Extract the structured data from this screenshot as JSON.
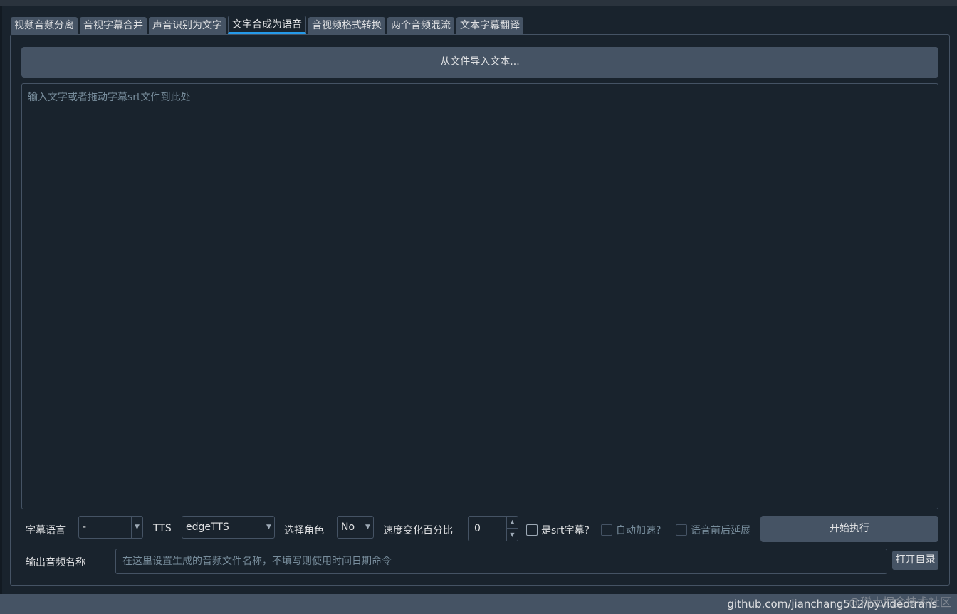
{
  "tabs": [
    {
      "label": "视频音频分离"
    },
    {
      "label": "音视字幕合并"
    },
    {
      "label": "声音识别为文字"
    },
    {
      "label": "文字合成为语音"
    },
    {
      "label": "音视频格式转换"
    },
    {
      "label": "两个音频混流"
    },
    {
      "label": "文本字幕翻译"
    }
  ],
  "active_tab": "文字合成为语音",
  "import_button": "从文件导入文本...",
  "text_area": {
    "placeholder": "输入文字或者拖动字幕srt文件到此处",
    "value": ""
  },
  "controls": {
    "subtitle_lang_label": "字幕语言",
    "subtitle_lang_value": "-",
    "tts_label": "TTS",
    "tts_value": "edgeTTS",
    "voice_label": "选择角色",
    "voice_value": "No",
    "speed_label": "速度变化百分比",
    "speed_value": "0",
    "is_srt_label": "是srt字幕?",
    "auto_speed_label": "自动加速?",
    "voice_extend_label": "语音前后延展",
    "run_button": "开始执行"
  },
  "output": {
    "label": "输出音频名称",
    "placeholder": "在这里设置生成的音频文件名称，不填写则使用时间日期命令",
    "open_dir_button": "打开目录"
  },
  "status_bar": {
    "text": "github.com/jianchang512/pyvideotrans"
  },
  "watermark": "@稀土掘金技术社区",
  "colors": {
    "accent": "#259ae9",
    "background": "#19232d",
    "button": "#455364"
  }
}
